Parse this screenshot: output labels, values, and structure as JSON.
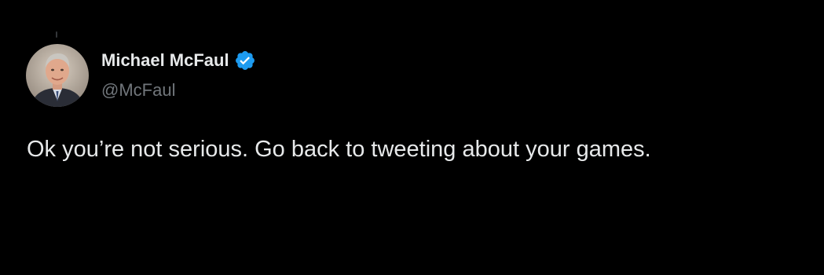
{
  "colors": {
    "background": "#000000",
    "primary_text": "#e7e9ea",
    "secondary_text": "#71767b",
    "verified_badge": "#1d9bf0",
    "thread_line": "#333639"
  },
  "tweet": {
    "author": {
      "display_name": "Michael McFaul",
      "handle": "@McFaul",
      "avatar_icon": "avatar-photo",
      "verified_icon": "verified-badge-icon"
    },
    "text": "Ok you’re not serious. Go back to tweeting about your games."
  }
}
